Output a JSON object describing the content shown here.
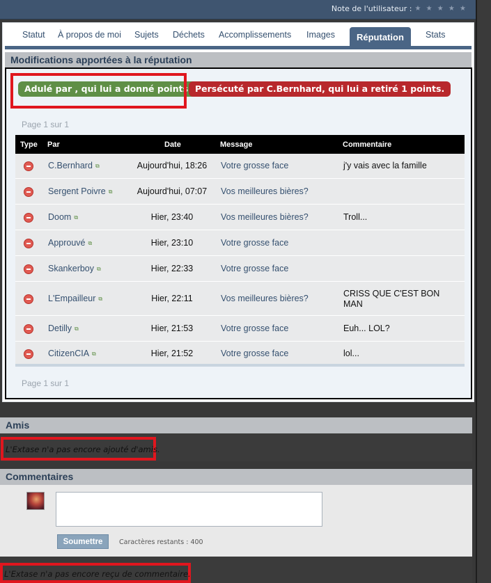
{
  "header": {
    "rating_label": "Note de l'utilisateur :",
    "stars": "★ ★ ★ ★ ★"
  },
  "tabs": [
    {
      "label": "Statut",
      "active": false
    },
    {
      "label": "À propos de moi",
      "active": false
    },
    {
      "label": "Sujets",
      "active": false
    },
    {
      "label": "Déchets",
      "active": false
    },
    {
      "label": "Accomplissements",
      "active": false
    },
    {
      "label": "Images",
      "active": false
    },
    {
      "label": "Réputation",
      "active": true
    },
    {
      "label": "Stats",
      "active": false
    }
  ],
  "reputation": {
    "title": "Modifications apportées à la réputation",
    "positive_summary": "Adulé par , qui lui a donné points.",
    "negative_summary": "Persécuté par C.Bernhard, qui lui a retiré 1 points.",
    "pager_top": "Page 1 sur 1",
    "pager_bottom": "Page 1 sur 1",
    "columns": {
      "type": "Type",
      "by": "Par",
      "date": "Date",
      "message": "Message",
      "comment": "Commentaire"
    },
    "rows": [
      {
        "type": "negative",
        "user": "C.Bernhard",
        "date": "Aujourd'hui, 18:26",
        "message": "Votre grosse face",
        "comment": "j'y vais avec la famille"
      },
      {
        "type": "negative",
        "user": "Sergent Poivre",
        "date": "Aujourd'hui, 07:07",
        "message": "Vos meilleures bières?",
        "comment": ""
      },
      {
        "type": "negative",
        "user": "Doom",
        "date": "Hier, 23:40",
        "message": "Vos meilleures bières?",
        "comment": "Troll..."
      },
      {
        "type": "negative",
        "user": "Approuvé",
        "date": "Hier, 23:10",
        "message": "Votre grosse face",
        "comment": ""
      },
      {
        "type": "negative",
        "user": "Skankerboy",
        "date": "Hier, 22:33",
        "message": "Votre grosse face",
        "comment": ""
      },
      {
        "type": "negative",
        "user": "L'Empailleur",
        "date": "Hier, 22:11",
        "message": "Vos meilleures bières?",
        "comment": "CRISS QUE C'EST BON MAN"
      },
      {
        "type": "negative",
        "user": "Detilly",
        "date": "Hier, 21:53",
        "message": "Votre grosse face",
        "comment": "Euh... LOL?"
      },
      {
        "type": "negative",
        "user": "CitizenCIA",
        "date": "Hier, 21:52",
        "message": "Votre grosse face",
        "comment": "lol..."
      }
    ]
  },
  "friends": {
    "title": "Amis",
    "empty_notice": "L'Extase n'a pas encore ajouté d'amis."
  },
  "comments": {
    "title": "Commentaires",
    "textarea_value": "",
    "submit_label": "Soumettre",
    "remaining_label": "Caractères restants : 400",
    "empty_notice": "L'Extase n'a pas encore reçu de commentaire."
  },
  "colors": {
    "accent": "#4a6585",
    "positive": "#5f8f46",
    "negative": "#b8282c",
    "highlight_box": "#e0161e"
  }
}
